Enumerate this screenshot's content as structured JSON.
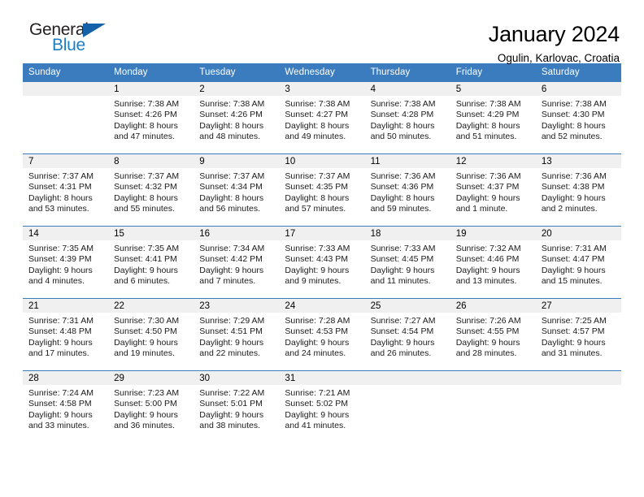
{
  "brand": {
    "name_part1": "General",
    "name_part2": "Blue",
    "triangle_icon": "triangle-icon",
    "accent_color": "#1c7fc4",
    "header_color": "#3a7cbe"
  },
  "header": {
    "title": "January 2024",
    "subtitle": "Ogulin, Karlovac, Croatia"
  },
  "calendar": {
    "weekday_headers": [
      "Sunday",
      "Monday",
      "Tuesday",
      "Wednesday",
      "Thursday",
      "Friday",
      "Saturday"
    ],
    "weeks": [
      [
        {
          "day": "",
          "sunrise": "",
          "sunset": "",
          "daylight1": "",
          "daylight2": "",
          "blank": true
        },
        {
          "day": "1",
          "sunrise": "Sunrise: 7:38 AM",
          "sunset": "Sunset: 4:26 PM",
          "daylight1": "Daylight: 8 hours",
          "daylight2": "and 47 minutes."
        },
        {
          "day": "2",
          "sunrise": "Sunrise: 7:38 AM",
          "sunset": "Sunset: 4:26 PM",
          "daylight1": "Daylight: 8 hours",
          "daylight2": "and 48 minutes."
        },
        {
          "day": "3",
          "sunrise": "Sunrise: 7:38 AM",
          "sunset": "Sunset: 4:27 PM",
          "daylight1": "Daylight: 8 hours",
          "daylight2": "and 49 minutes."
        },
        {
          "day": "4",
          "sunrise": "Sunrise: 7:38 AM",
          "sunset": "Sunset: 4:28 PM",
          "daylight1": "Daylight: 8 hours",
          "daylight2": "and 50 minutes."
        },
        {
          "day": "5",
          "sunrise": "Sunrise: 7:38 AM",
          "sunset": "Sunset: 4:29 PM",
          "daylight1": "Daylight: 8 hours",
          "daylight2": "and 51 minutes."
        },
        {
          "day": "6",
          "sunrise": "Sunrise: 7:38 AM",
          "sunset": "Sunset: 4:30 PM",
          "daylight1": "Daylight: 8 hours",
          "daylight2": "and 52 minutes."
        }
      ],
      [
        {
          "day": "7",
          "sunrise": "Sunrise: 7:37 AM",
          "sunset": "Sunset: 4:31 PM",
          "daylight1": "Daylight: 8 hours",
          "daylight2": "and 53 minutes."
        },
        {
          "day": "8",
          "sunrise": "Sunrise: 7:37 AM",
          "sunset": "Sunset: 4:32 PM",
          "daylight1": "Daylight: 8 hours",
          "daylight2": "and 55 minutes."
        },
        {
          "day": "9",
          "sunrise": "Sunrise: 7:37 AM",
          "sunset": "Sunset: 4:34 PM",
          "daylight1": "Daylight: 8 hours",
          "daylight2": "and 56 minutes."
        },
        {
          "day": "10",
          "sunrise": "Sunrise: 7:37 AM",
          "sunset": "Sunset: 4:35 PM",
          "daylight1": "Daylight: 8 hours",
          "daylight2": "and 57 minutes."
        },
        {
          "day": "11",
          "sunrise": "Sunrise: 7:36 AM",
          "sunset": "Sunset: 4:36 PM",
          "daylight1": "Daylight: 8 hours",
          "daylight2": "and 59 minutes."
        },
        {
          "day": "12",
          "sunrise": "Sunrise: 7:36 AM",
          "sunset": "Sunset: 4:37 PM",
          "daylight1": "Daylight: 9 hours",
          "daylight2": "and 1 minute."
        },
        {
          "day": "13",
          "sunrise": "Sunrise: 7:36 AM",
          "sunset": "Sunset: 4:38 PM",
          "daylight1": "Daylight: 9 hours",
          "daylight2": "and 2 minutes."
        }
      ],
      [
        {
          "day": "14",
          "sunrise": "Sunrise: 7:35 AM",
          "sunset": "Sunset: 4:39 PM",
          "daylight1": "Daylight: 9 hours",
          "daylight2": "and 4 minutes."
        },
        {
          "day": "15",
          "sunrise": "Sunrise: 7:35 AM",
          "sunset": "Sunset: 4:41 PM",
          "daylight1": "Daylight: 9 hours",
          "daylight2": "and 6 minutes."
        },
        {
          "day": "16",
          "sunrise": "Sunrise: 7:34 AM",
          "sunset": "Sunset: 4:42 PM",
          "daylight1": "Daylight: 9 hours",
          "daylight2": "and 7 minutes."
        },
        {
          "day": "17",
          "sunrise": "Sunrise: 7:33 AM",
          "sunset": "Sunset: 4:43 PM",
          "daylight1": "Daylight: 9 hours",
          "daylight2": "and 9 minutes."
        },
        {
          "day": "18",
          "sunrise": "Sunrise: 7:33 AM",
          "sunset": "Sunset: 4:45 PM",
          "daylight1": "Daylight: 9 hours",
          "daylight2": "and 11 minutes."
        },
        {
          "day": "19",
          "sunrise": "Sunrise: 7:32 AM",
          "sunset": "Sunset: 4:46 PM",
          "daylight1": "Daylight: 9 hours",
          "daylight2": "and 13 minutes."
        },
        {
          "day": "20",
          "sunrise": "Sunrise: 7:31 AM",
          "sunset": "Sunset: 4:47 PM",
          "daylight1": "Daylight: 9 hours",
          "daylight2": "and 15 minutes."
        }
      ],
      [
        {
          "day": "21",
          "sunrise": "Sunrise: 7:31 AM",
          "sunset": "Sunset: 4:48 PM",
          "daylight1": "Daylight: 9 hours",
          "daylight2": "and 17 minutes."
        },
        {
          "day": "22",
          "sunrise": "Sunrise: 7:30 AM",
          "sunset": "Sunset: 4:50 PM",
          "daylight1": "Daylight: 9 hours",
          "daylight2": "and 19 minutes."
        },
        {
          "day": "23",
          "sunrise": "Sunrise: 7:29 AM",
          "sunset": "Sunset: 4:51 PM",
          "daylight1": "Daylight: 9 hours",
          "daylight2": "and 22 minutes."
        },
        {
          "day": "24",
          "sunrise": "Sunrise: 7:28 AM",
          "sunset": "Sunset: 4:53 PM",
          "daylight1": "Daylight: 9 hours",
          "daylight2": "and 24 minutes."
        },
        {
          "day": "25",
          "sunrise": "Sunrise: 7:27 AM",
          "sunset": "Sunset: 4:54 PM",
          "daylight1": "Daylight: 9 hours",
          "daylight2": "and 26 minutes."
        },
        {
          "day": "26",
          "sunrise": "Sunrise: 7:26 AM",
          "sunset": "Sunset: 4:55 PM",
          "daylight1": "Daylight: 9 hours",
          "daylight2": "and 28 minutes."
        },
        {
          "day": "27",
          "sunrise": "Sunrise: 7:25 AM",
          "sunset": "Sunset: 4:57 PM",
          "daylight1": "Daylight: 9 hours",
          "daylight2": "and 31 minutes."
        }
      ],
      [
        {
          "day": "28",
          "sunrise": "Sunrise: 7:24 AM",
          "sunset": "Sunset: 4:58 PM",
          "daylight1": "Daylight: 9 hours",
          "daylight2": "and 33 minutes."
        },
        {
          "day": "29",
          "sunrise": "Sunrise: 7:23 AM",
          "sunset": "Sunset: 5:00 PM",
          "daylight1": "Daylight: 9 hours",
          "daylight2": "and 36 minutes."
        },
        {
          "day": "30",
          "sunrise": "Sunrise: 7:22 AM",
          "sunset": "Sunset: 5:01 PM",
          "daylight1": "Daylight: 9 hours",
          "daylight2": "and 38 minutes."
        },
        {
          "day": "31",
          "sunrise": "Sunrise: 7:21 AM",
          "sunset": "Sunset: 5:02 PM",
          "daylight1": "Daylight: 9 hours",
          "daylight2": "and 41 minutes."
        },
        {
          "day": "",
          "sunrise": "",
          "sunset": "",
          "daylight1": "",
          "daylight2": "",
          "empty": true
        },
        {
          "day": "",
          "sunrise": "",
          "sunset": "",
          "daylight1": "",
          "daylight2": "",
          "empty": true
        },
        {
          "day": "",
          "sunrise": "",
          "sunset": "",
          "daylight1": "",
          "daylight2": "",
          "empty": true
        }
      ]
    ]
  }
}
